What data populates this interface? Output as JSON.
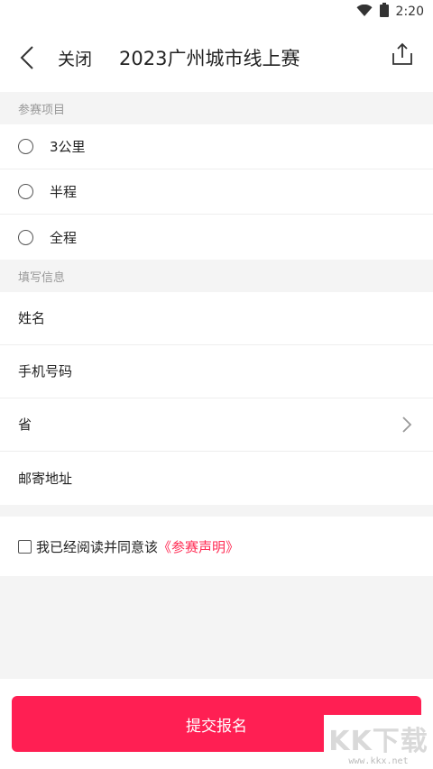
{
  "status_bar": {
    "time": "2:20",
    "icons": [
      "wifi-icon",
      "battery-icon"
    ]
  },
  "nav": {
    "back_icon": "chevron-left-icon",
    "close_label": "关闭",
    "title": "2023广州城市线上赛",
    "share_icon": "share-icon"
  },
  "sections": {
    "event_header": "参赛项目",
    "events": [
      {
        "label": "3公里",
        "selected": false
      },
      {
        "label": "半程",
        "selected": false
      },
      {
        "label": "全程",
        "selected": false
      }
    ],
    "info_header": "填写信息",
    "fields": [
      {
        "placeholder": "姓名",
        "value": ""
      },
      {
        "placeholder": "手机号码",
        "value": ""
      },
      {
        "placeholder": "省",
        "value": ""
      },
      {
        "placeholder": "邮寄地址",
        "value": ""
      }
    ]
  },
  "agreement": {
    "checked": false,
    "text": "我已经阅读并同意该",
    "link_text": "《参赛声明》",
    "link_color": "#ff2d55"
  },
  "submit": {
    "label": "提交报名",
    "color": "#ff1f53"
  },
  "watermark": {
    "logo": "KK下载",
    "url": "www.kkx.net"
  }
}
